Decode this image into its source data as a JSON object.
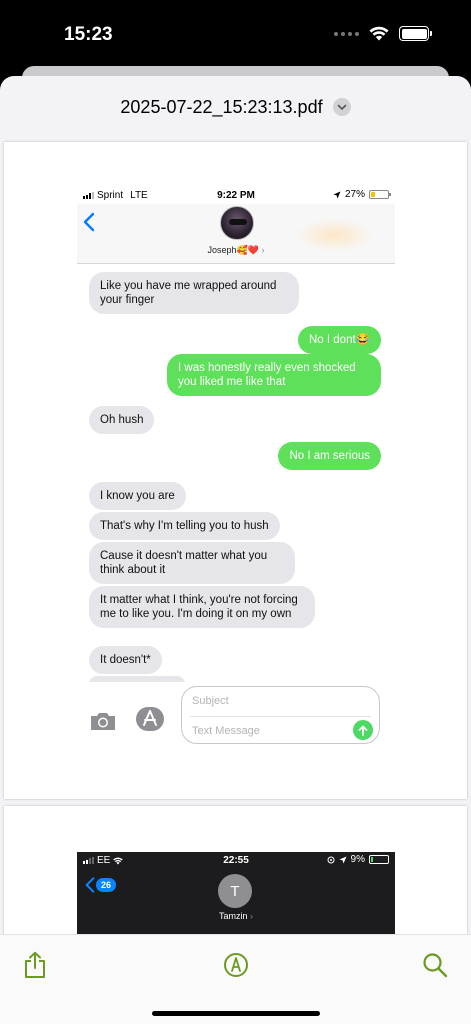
{
  "status_bar": {
    "time": "15:23"
  },
  "document": {
    "title": "2025-07-22_15:23:13.pdf"
  },
  "screenshot1": {
    "status": {
      "carrier": "Sprint",
      "network": "LTE",
      "time": "9:22 PM",
      "battery": "27%",
      "battery_level": 0.27
    },
    "contact_name": "Joseph🥰❤️",
    "messages": [
      {
        "dir": "in",
        "text": "Like you have me wrapped around your finger"
      },
      {
        "dir": "out",
        "text": "No I dont😂"
      },
      {
        "dir": "out",
        "text": "I was honestly really even shocked you liked me like that"
      },
      {
        "dir": "in",
        "text": "Oh hush"
      },
      {
        "dir": "out",
        "text": "No I am serious"
      },
      {
        "dir": "in",
        "text": "I know you are"
      },
      {
        "dir": "in",
        "text": "That's why I'm telling you to hush"
      },
      {
        "dir": "in",
        "text": "Cause it doesn't matter what you think about it"
      },
      {
        "dir": "in",
        "text": "It matter what I think, you're not forcing me to like you. I'm doing it on my own"
      },
      {
        "dir": "in",
        "text": "It doesn't*"
      }
    ],
    "compose": {
      "subject_placeholder": "Subject",
      "text_placeholder": "Text Message"
    },
    "colors": {
      "incoming": "#e5e5ea",
      "outgoing": "#5ee05a",
      "link_blue": "#007aff"
    }
  },
  "screenshot2": {
    "status": {
      "carrier": "EE",
      "time": "22:55",
      "battery": "9%",
      "battery_level": 0.09
    },
    "back_count": "26",
    "avatar_initial": "T",
    "contact_name": "Tamzin"
  },
  "toolbar": {
    "share_icon": "share-icon",
    "markup_icon": "markup-icon",
    "search_icon": "search-icon",
    "accent": "#6a9a1f"
  }
}
